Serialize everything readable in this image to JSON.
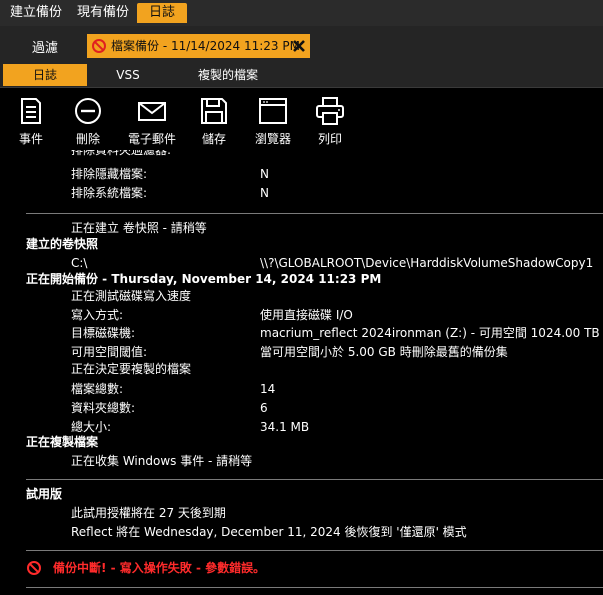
{
  "top_tabs": [
    "建立備份",
    "現有備份",
    "日誌"
  ],
  "row2": {
    "filter": "過濾",
    "log_tab_title": "檔案備份 - 11/14/2024 11:23 PM"
  },
  "sub_tabs": [
    "日誌",
    "VSS",
    "複製的檔案"
  ],
  "toolbar": [
    "事件",
    "刪除",
    "電子郵件",
    "儲存",
    "瀏覽器",
    "列印"
  ],
  "log": {
    "partial_top": "排除資料夾過濾器:",
    "excl_hidden_label": "排除隱藏檔案:",
    "excl_hidden_value": "N",
    "excl_system_label": "排除系統檔案:",
    "excl_system_value": "N",
    "creating_snapshot": "正在建立 卷快照 - 請稍等",
    "snapshot_header": "建立的卷快照",
    "snapshot_drive": "C:\\",
    "snapshot_path": "\\\\?\\GLOBALROOT\\Device\\HarddiskVolumeShadowCopy1",
    "start_header": "正在開始備份 - Thursday, November 14, 2024 11:23 PM",
    "testing_speed": "正在測試磁碟寫入速度",
    "write_mode_label": "寫入方式:",
    "write_mode_value": "使用直接磁碟 I/O",
    "target_label": "目標磁碟機:",
    "target_value": "macrium_reflect 2024ironman (Z:) - 可用空間 1024.00 TB",
    "threshold_label": "可用空間閾值:",
    "threshold_value": "當可用空間小於 5.00 GB 時刪除最舊的備份集",
    "deciding_files": "正在決定要複製的檔案",
    "total_files_label": "檔案總數:",
    "total_files_value": "14",
    "total_folders_label": "資料夾總數:",
    "total_folders_value": "6",
    "total_size_label": "總大小:",
    "total_size_value": "34.1 MB",
    "copying_header": "正在複製檔案",
    "collecting_events": "正在收集 Windows 事件 - 請稍等",
    "trial_header": "試用版",
    "trial_line1": "此試用授權將在 27 天後到期",
    "trial_line2": "Reflect 將在 Wednesday, December 11, 2024 後恢復到 '僅還原' 模式",
    "error_line": "備份中斷! - 寫入操作失敗 - 參數錯誤。"
  },
  "colors": {
    "accent": "#f2a31f",
    "error": "#ff2b2b"
  }
}
